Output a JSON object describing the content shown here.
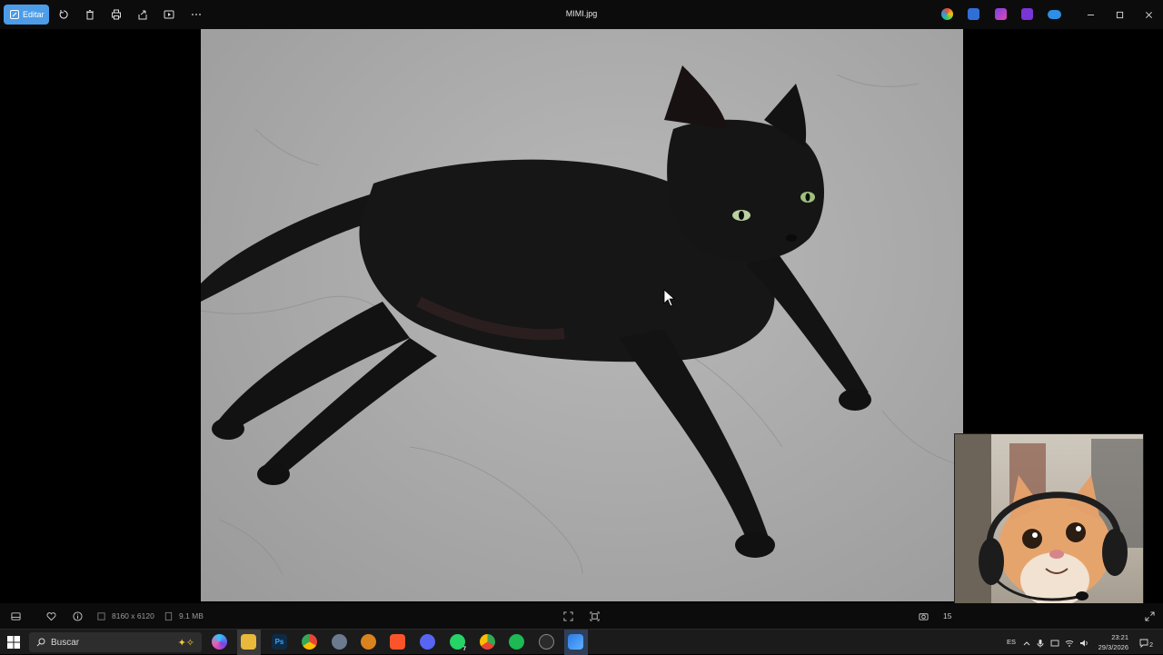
{
  "toolbar": {
    "edit_label": "Editar",
    "title": "MIMI.jpg"
  },
  "statusbar": {
    "dimensions": "8160 x 6120",
    "file_size": "9.1 MB",
    "zoom_partial": "15"
  },
  "taskbar": {
    "search_label": "Buscar",
    "language": "ES",
    "time": "23:21",
    "date": "29/3/2026",
    "notification_count": "2",
    "whatsapp_badge": "7"
  },
  "colors": {
    "accent": "#4c9ce8",
    "background": "#000000",
    "taskbar": "#1b1b1b"
  }
}
